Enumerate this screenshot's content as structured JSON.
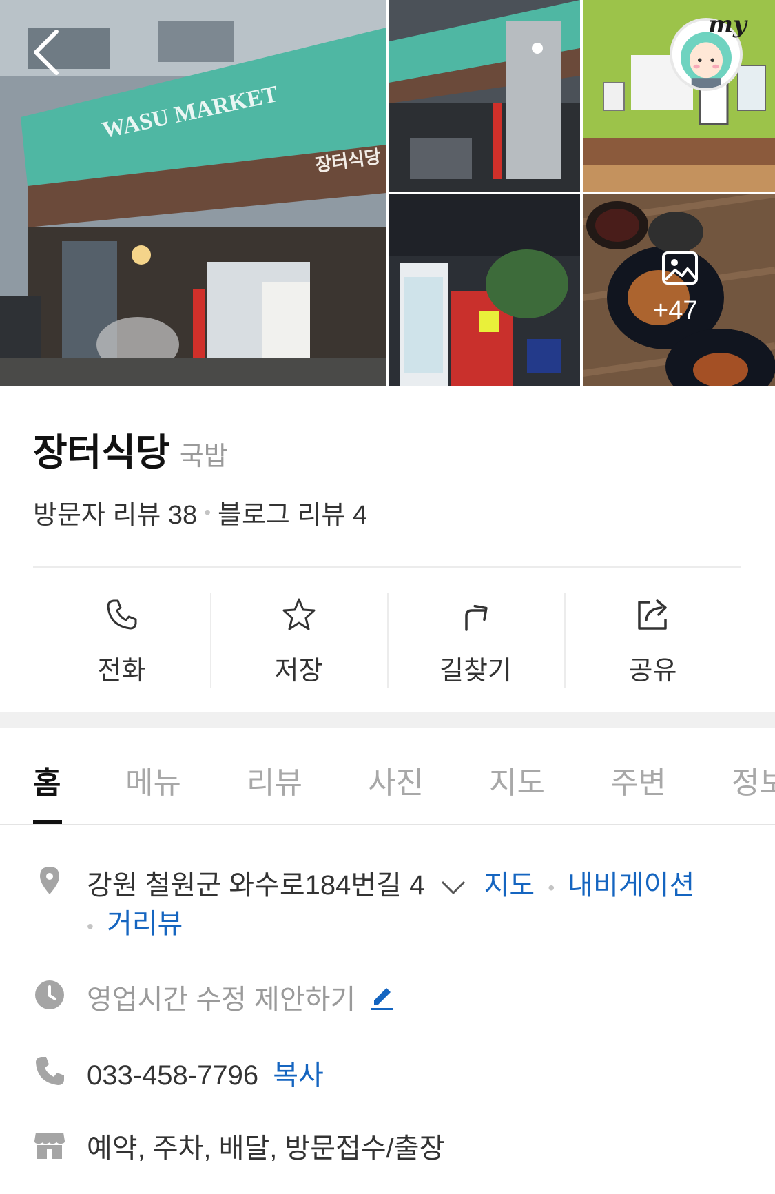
{
  "photos": {
    "main_sign": "WASU MARKET",
    "main_store_sign": "장터식당",
    "more_count": "+47"
  },
  "header": {
    "my_label": "my"
  },
  "place": {
    "name": "장터식당",
    "category": "국밥",
    "visitor_review": "방문자 리뷰 38",
    "blog_review": "블로그 리뷰 4"
  },
  "actions": [
    {
      "label": "전화",
      "icon": "phone-icon"
    },
    {
      "label": "저장",
      "icon": "star-icon"
    },
    {
      "label": "길찾기",
      "icon": "directions-icon"
    },
    {
      "label": "공유",
      "icon": "share-icon"
    }
  ],
  "tabs": [
    "홈",
    "메뉴",
    "리뷰",
    "사진",
    "지도",
    "주변",
    "정보"
  ],
  "info": {
    "address": "강원 철원군 와수로184번길 4",
    "map_link": "지도",
    "navigation_link": "내비게이션",
    "roadview_link": "거리뷰",
    "hours_suggest": "영업시간 수정 제안하기",
    "phone": "033-458-7796",
    "copy_label": "복사",
    "services": "예약, 주차, 배달, 방문접수/출장"
  },
  "colors": {
    "link": "#1565c0",
    "accent_teal": "#4fb7a3",
    "text_primary": "#111111",
    "text_muted": "#9a9a9a"
  }
}
